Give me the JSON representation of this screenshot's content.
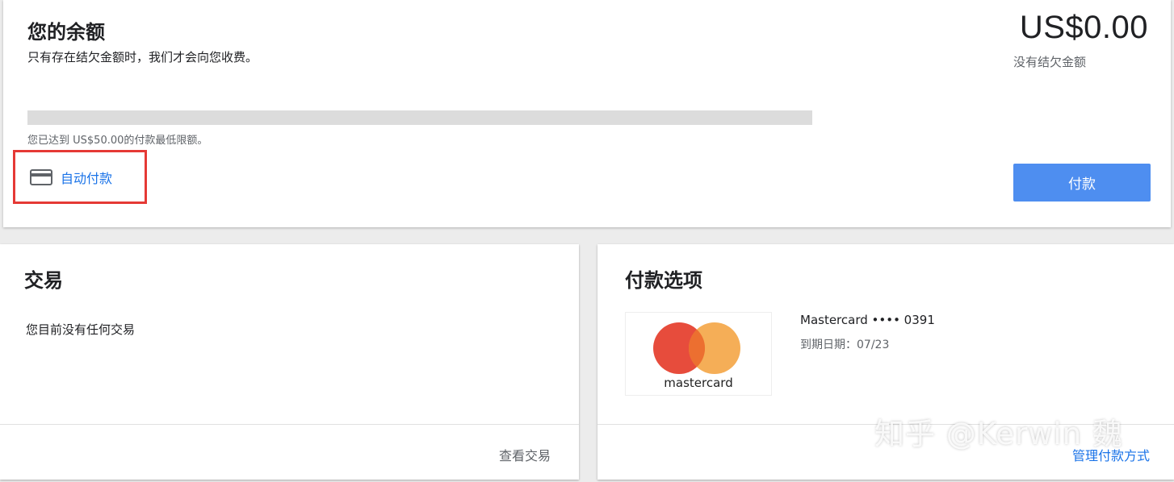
{
  "balance": {
    "title": "您的余额",
    "subtitle": "只有存在结欠金额时，我们才会向您收费。",
    "amount": "US$0.00",
    "amount_caption": "没有结欠金额",
    "progress_fraction": 0,
    "threshold_text": "您已达到 US$50.00的付款最低限额。",
    "auto_pay_label": "自动付款",
    "auto_pay_icon": "credit-card-icon",
    "pay_button_label": "付款"
  },
  "transactions": {
    "title": "交易",
    "empty_text": "您目前没有任何交易",
    "view_link": "查看交易"
  },
  "payment_options": {
    "title": "付款选项",
    "card_brand_logo": "mastercard",
    "card_name": "Mastercard •••• 0391",
    "card_expiry": "到期日期：07/23",
    "manage_link": "管理付款方式"
  },
  "watermark": "知乎 @Kerwin 魏",
  "colors": {
    "accent": "#1a73e8",
    "pay_button": "#4e8ef0",
    "highlight_border": "#e53935",
    "mc_red": "#eb001b",
    "mc_orange": "#f79e1b"
  }
}
